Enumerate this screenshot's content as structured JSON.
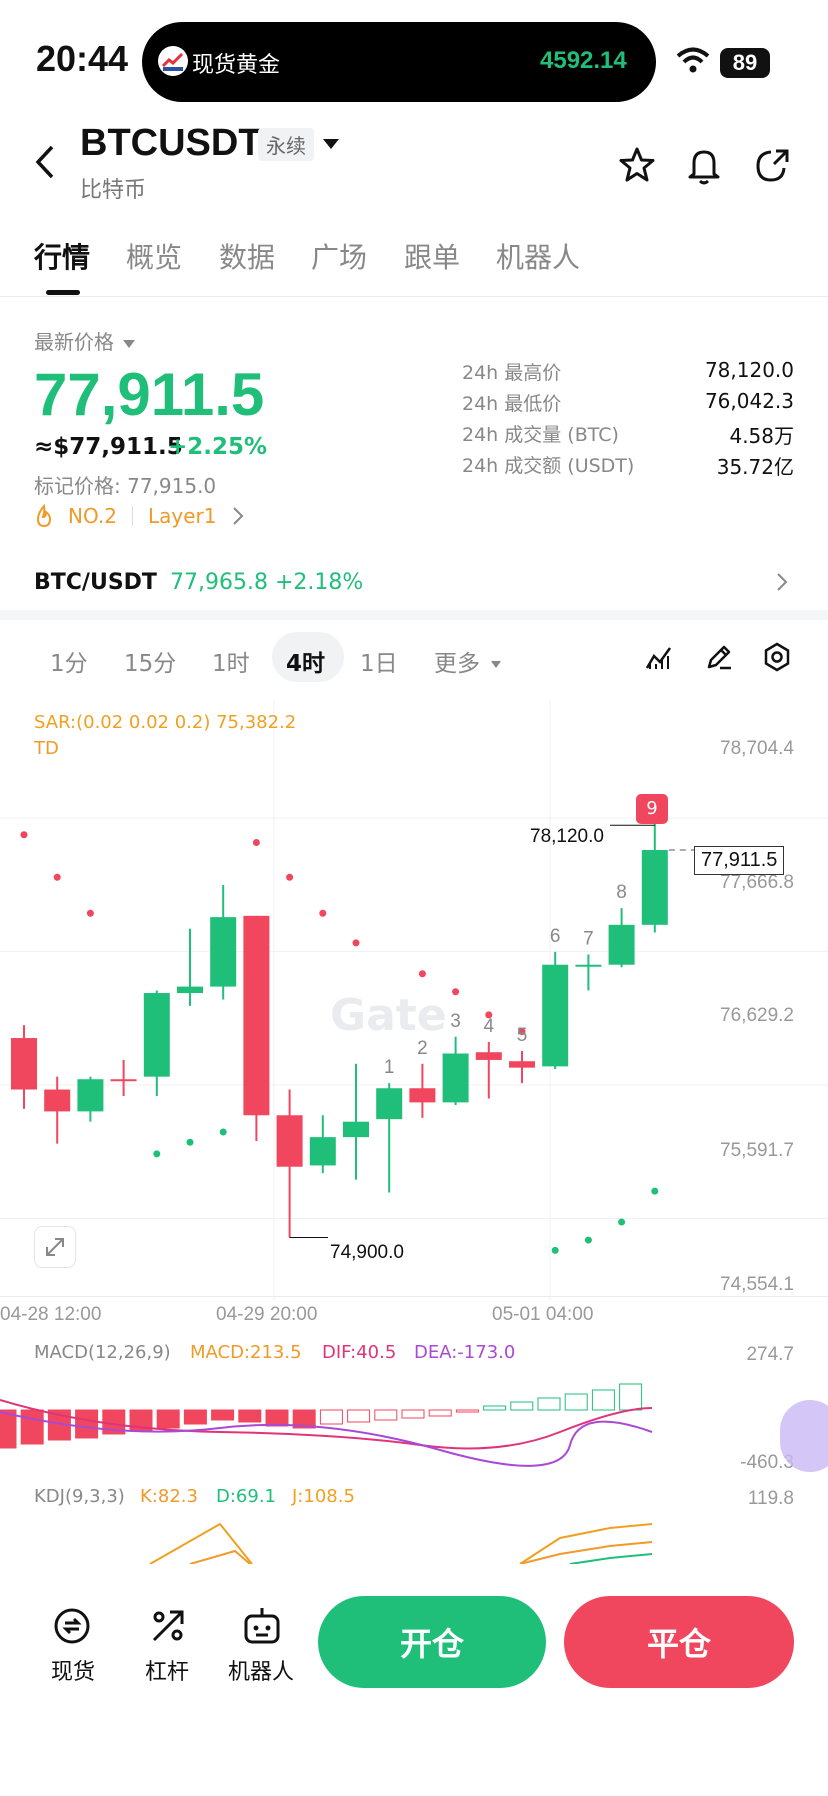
{
  "status": {
    "time": "20:44",
    "island_name": "现货黄金",
    "island_price": "4592.14",
    "battery": "89"
  },
  "header": {
    "symbol": "BTCUSDT",
    "tag": "永续",
    "subtitle": "比特币"
  },
  "tabs": [
    "行情",
    "概览",
    "数据",
    "广场",
    "跟单",
    "机器人"
  ],
  "price": {
    "label": "最新价格",
    "last": "77,911.5",
    "usd": "≈$77,911.5",
    "change": "+2.25%",
    "mark": "标记价格: 77,915.0",
    "rank": "NO.2",
    "category": "Layer1"
  },
  "stats": [
    {
      "label": "24h 最高价",
      "value": "78,120.0"
    },
    {
      "label": "24h 最低价",
      "value": "76,042.3"
    },
    {
      "label": "24h 成交量 (BTC)",
      "value": "4.58万"
    },
    {
      "label": "24h 成交额 (USDT)",
      "value": "35.72亿"
    }
  ],
  "spot": {
    "pair": "BTC/USDT",
    "price": "77,965.8",
    "change": "+2.18%"
  },
  "timeframes": [
    "1分",
    "15分",
    "1时",
    "4时",
    "1日",
    "更多"
  ],
  "chart": {
    "sar_label": "SAR:(0.02 0.02 0.2) 75,382.2",
    "td_label": "TD",
    "y_ticks": [
      "78,704.4",
      "77,666.8",
      "76,629.2",
      "75,591.7",
      "74,554.1"
    ],
    "x_ticks": [
      "04-28 12:00",
      "04-29 20:00",
      "05-01 04:00"
    ],
    "high_label": "78,120.0",
    "low_label": "74,900.0",
    "current": "77,911.5",
    "td_badge": "9",
    "watermark": "Gate",
    "td_counts": [
      "1",
      "2",
      "3",
      "4",
      "5",
      "6",
      "7",
      "8"
    ]
  },
  "chart_data": {
    "type": "candlestick",
    "ylim": [
      74554.1,
      78704.4
    ],
    "candles": [
      {
        "o": 76450,
        "h": 76550,
        "l": 75900,
        "c": 76050
      },
      {
        "o": 76050,
        "h": 76150,
        "l": 75630,
        "c": 75880
      },
      {
        "o": 75880,
        "h": 76150,
        "l": 75800,
        "c": 76130
      },
      {
        "o": 76130,
        "h": 76280,
        "l": 76000,
        "c": 76120
      },
      {
        "o": 76150,
        "h": 76820,
        "l": 76000,
        "c": 76800
      },
      {
        "o": 76800,
        "h": 77300,
        "l": 76700,
        "c": 76850
      },
      {
        "o": 76850,
        "h": 77640,
        "l": 76750,
        "c": 77390
      },
      {
        "o": 77400,
        "h": 77400,
        "l": 75650,
        "c": 75850
      },
      {
        "o": 75850,
        "h": 76050,
        "l": 74900,
        "c": 75450
      },
      {
        "o": 75460,
        "h": 75850,
        "l": 75400,
        "c": 75680
      },
      {
        "o": 75680,
        "h": 76250,
        "l": 75350,
        "c": 75800
      },
      {
        "o": 75820,
        "h": 76100,
        "l": 75250,
        "c": 76060
      },
      {
        "o": 76060,
        "h": 76250,
        "l": 75830,
        "c": 75950
      },
      {
        "o": 75950,
        "h": 76460,
        "l": 75930,
        "c": 76330
      },
      {
        "o": 76340,
        "h": 76420,
        "l": 75980,
        "c": 76280
      },
      {
        "o": 76270,
        "h": 76350,
        "l": 76100,
        "c": 76220
      },
      {
        "o": 76230,
        "h": 77120,
        "l": 76210,
        "c": 77020
      },
      {
        "o": 77020,
        "h": 77100,
        "l": 76820,
        "c": 77020
      },
      {
        "o": 77020,
        "h": 77460,
        "l": 77000,
        "c": 77330
      },
      {
        "o": 77330,
        "h": 78120,
        "l": 77270,
        "c": 77911.5
      }
    ],
    "sar_upper": [
      77970,
      77700,
      77420,
      77190,
      77040,
      76950,
      76810,
      76630
    ],
    "sar_lower": [
      75550,
      75640,
      75720,
      75800,
      74800,
      74880,
      75020,
      75260
    ]
  },
  "macd": {
    "label": "MACD(12,26,9)",
    "macd": "MACD:213.5",
    "dif": "DIF:40.5",
    "dea": "DEA:-173.0",
    "top": "274.7",
    "bottom": "-460.3"
  },
  "kdj": {
    "label": "KDJ(9,3,3)",
    "k": "K:82.3",
    "d": "D:69.1",
    "j": "J:108.5",
    "top": "119.8"
  },
  "bottom_bar": {
    "spot": "现货",
    "leverage": "杠杆",
    "bot": "机器人",
    "open": "开仓",
    "close": "平仓"
  },
  "colors": {
    "up": "#1fbf7a",
    "down": "#f0465e",
    "sar": "#f0a020"
  }
}
